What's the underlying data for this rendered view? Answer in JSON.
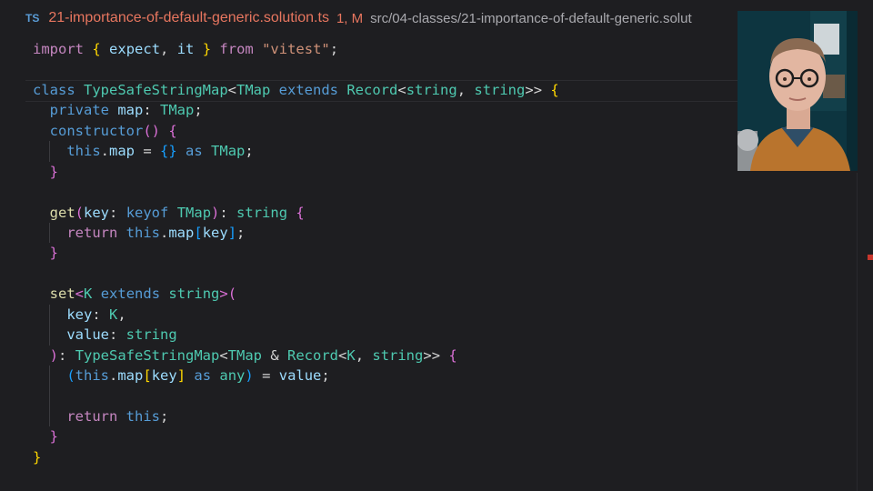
{
  "tab": {
    "icon_label": "TS",
    "filename": "21-importance-of-default-generic.solution.ts",
    "status": "1, M",
    "path": "src/04-classes/21-importance-of-default-generic.solut"
  },
  "code": {
    "l1_import": "import",
    "l1_expect": "expect",
    "l1_it": "it",
    "l1_from": "from",
    "l1_module": "\"vitest\"",
    "class_kw": "class",
    "class_name": "TypeSafeStringMap",
    "tmap": "TMap",
    "extends_kw": "extends",
    "record": "Record",
    "string_kw": "string",
    "private_kw": "private",
    "map": "map",
    "constructor": "constructor",
    "this_kw": "this",
    "as_kw": "as",
    "get_fn": "get",
    "key": "key",
    "keyof_kw": "keyof",
    "return_kw": "return",
    "set_fn": "set",
    "k_param": "K",
    "value": "value",
    "any_kw": "any"
  },
  "colors": {
    "background": "#1e1e21",
    "tab_modified": "#e8765f",
    "scroll_error": "#c8372d"
  },
  "icons": [
    "typescript-file-icon"
  ],
  "webcam": {
    "description_icon": "presenter-webcam"
  }
}
